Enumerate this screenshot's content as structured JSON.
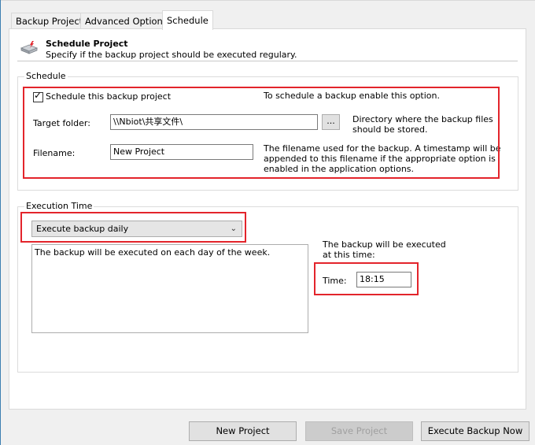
{
  "tabs": [
    {
      "label": "Backup Project"
    },
    {
      "label": "Advanced Options"
    },
    {
      "label": "Schedule"
    }
  ],
  "header": {
    "title": "Schedule Project",
    "description": "Specify if the backup project should be executed regulary."
  },
  "schedule_group": {
    "legend": "Schedule",
    "enable_label": "Schedule this backup project",
    "enable_checked": true,
    "enable_hint": "To schedule a backup enable this option.",
    "target_label": "Target folder:",
    "target_value": "\\\\Nbiot\\共享文件\\",
    "browse_label": "...",
    "target_hint_1": "Directory where the backup files",
    "target_hint_2": "should be stored.",
    "filename_label": "Filename:",
    "filename_value": "New Project",
    "filename_hint_1": "The filename used for the backup. A timestamp will be",
    "filename_hint_2": "appended to this filename if the appropriate option is",
    "filename_hint_3": "enabled in the application options."
  },
  "execution_group": {
    "legend": "Execution Time",
    "frequency_selected": "Execute backup daily",
    "description": "The backup will be executed on each day of the week.",
    "time_hint_1": "The backup will be executed",
    "time_hint_2": "at this time:",
    "time_label": "Time:",
    "time_value": "18:15"
  },
  "footer": {
    "new_project": "New Project",
    "save_project": "Save Project",
    "execute_now": "Execute Backup Now"
  },
  "colors": {
    "highlight_red": "#e3242b",
    "window_accent": "#3c7fb1"
  }
}
